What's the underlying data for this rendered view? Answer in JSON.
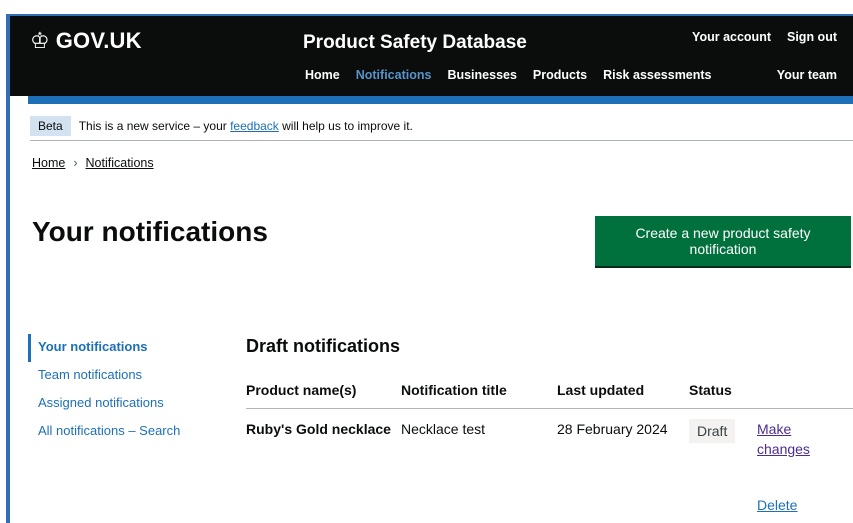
{
  "header": {
    "logo_text": "GOV.UK",
    "service_name": "Product Safety Database",
    "account_link": "Your account",
    "signout_link": "Sign out",
    "team_link": "Your team",
    "nav": [
      "Home",
      "Notifications",
      "Businesses",
      "Products",
      "Risk assessments"
    ],
    "active_nav": "Notifications"
  },
  "phase_banner": {
    "tag": "Beta",
    "text_before": "This is a new service – your",
    "link": "feedback",
    "text_after": "will help us to improve it."
  },
  "breadcrumbs": [
    "Home",
    "Notifications"
  ],
  "page": {
    "title": "Your notifications",
    "create_button": "Create a new product safety notification"
  },
  "sidenav": {
    "items": [
      "Your notifications",
      "Team notifications",
      "Assigned notifications",
      "All notifications – Search"
    ],
    "active": "Your notifications"
  },
  "drafts": {
    "title": "Draft notifications",
    "columns": [
      "Product name(s)",
      "Notification title",
      "Last updated",
      "Status"
    ],
    "rows": [
      {
        "product": "Ruby's Gold necklace",
        "notification_title": "Necklace test",
        "last_updated": "28 February 2024",
        "status": "Draft",
        "action_edit": "Make changes",
        "action_delete": "Delete"
      }
    ]
  },
  "colors": {
    "header_bg": "#0b0c0c",
    "brand_blue": "#1d70b8",
    "button_green": "#00703c",
    "frame_border": "#2f6fb6"
  }
}
